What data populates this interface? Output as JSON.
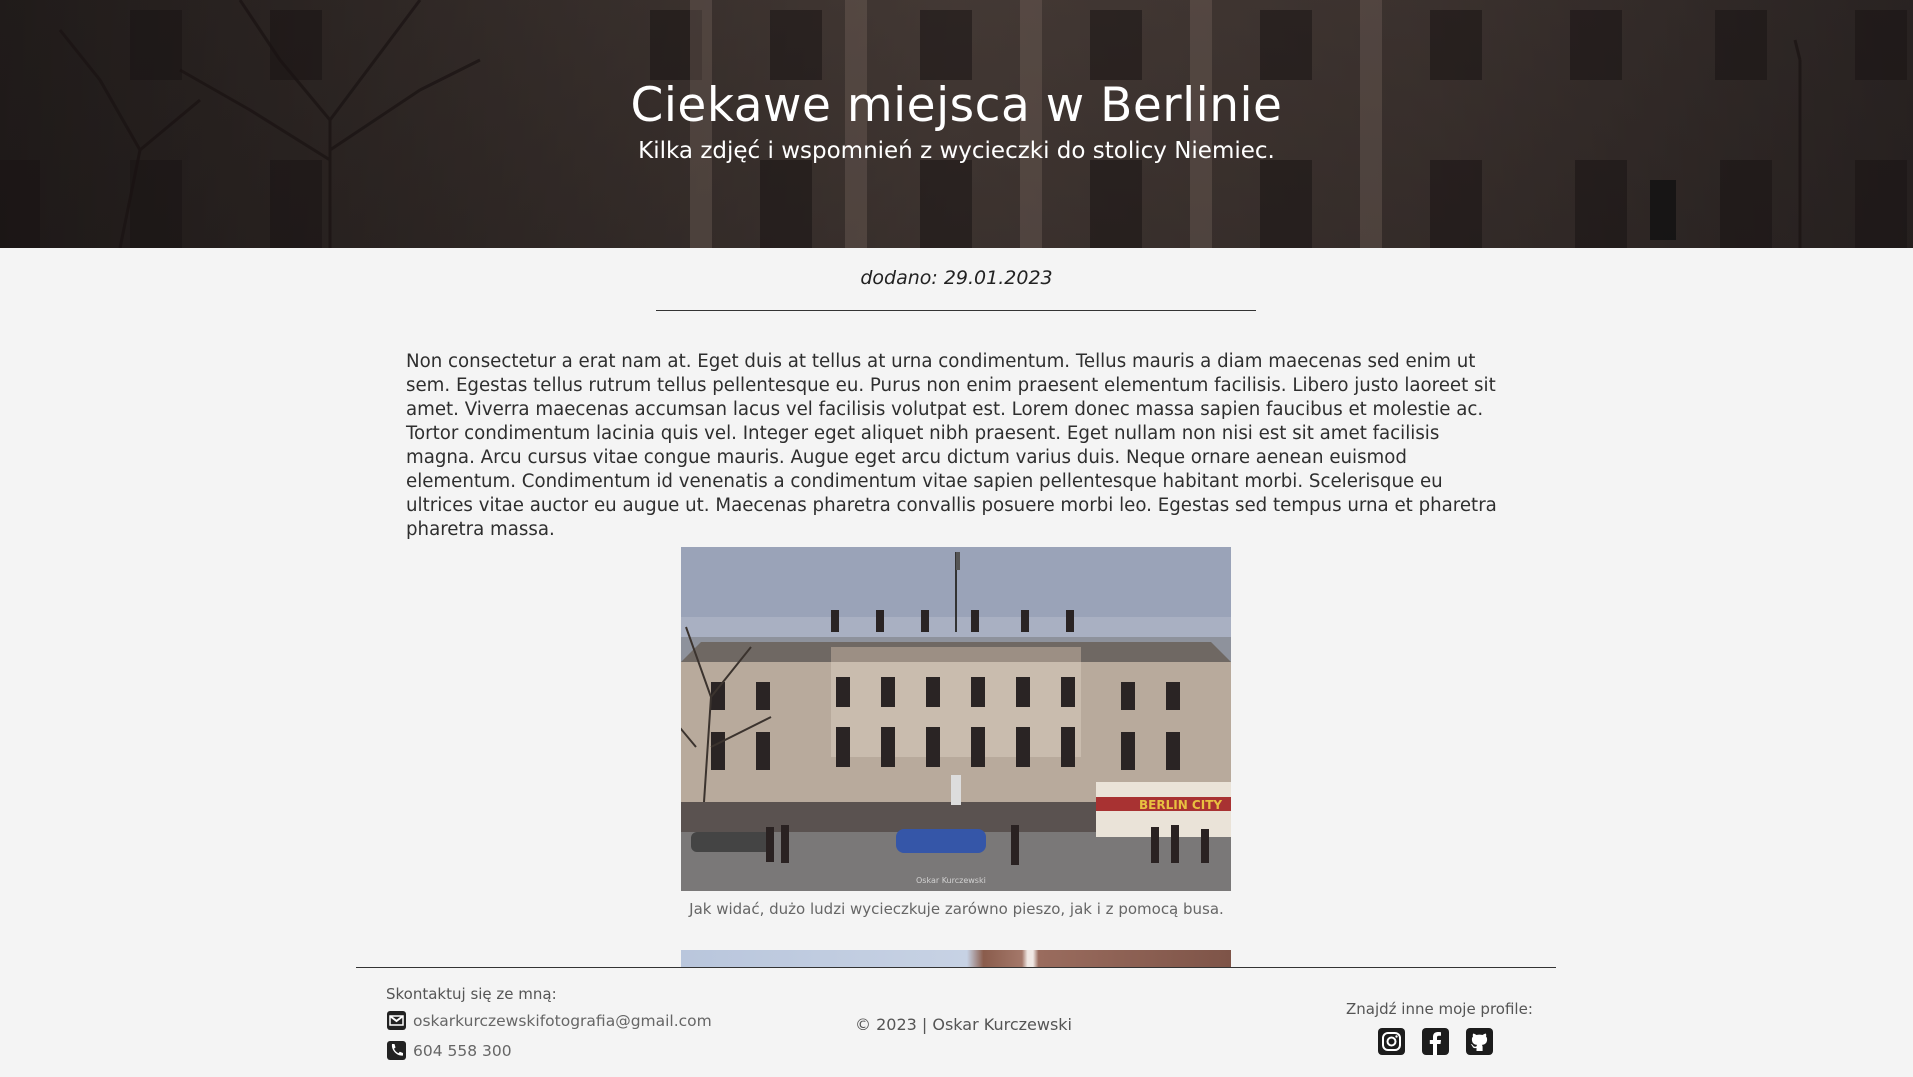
{
  "hero": {
    "title": "Ciekawe miejsca w Berlinie",
    "subtitle": "Kilka zdjęć i wspomnień z wycieczki do stolicy Niemiec."
  },
  "post": {
    "date": "dodano: 29.01.2023",
    "body": "Non consectetur a erat nam at. Eget duis at tellus at urna condimentum. Tellus mauris a diam maecenas sed enim ut sem. Egestas tellus rutrum tellus pellentesque eu. Purus non enim praesent elementum facilisis. Libero justo laoreet sit amet. Viverra maecenas accumsan lacus vel facilisis volutpat est. Lorem donec massa sapien faucibus et molestie ac. Tortor condimentum lacinia quis vel. Integer eget aliquet nibh praesent. Eget nullam non nisi est sit amet facilisis magna. Arcu cursus vitae congue mauris. Augue eget arcu dictum varius duis. Neque ornare aenean euismod elementum. Condimentum id venenatis a condimentum vitae sapien pellentesque habitant morbi. Scelerisque eu ultrices vitae auctor eu augue ut. Maecenas pharetra convallis posuere morbi leo. Egestas sed tempus urna et pharetra pharetra massa.",
    "photo_caption": "Jak widać, dużo ludzi wycieczkuje zarówno pieszo, jak i z pomocą busa.",
    "photo_bus_sign": "BERLIN CITY",
    "photo_watermark": "Oskar Kurczewski"
  },
  "footer": {
    "contact_title": "Skontaktuj się ze mną:",
    "email": "oskarkurczewskifotografia@gmail.com",
    "phone": "604 558 300",
    "copyright": "© 2023 | Oskar Kurczewski",
    "profiles_title": "Znajdź inne moje profile:",
    "icons": {
      "email": "envelope-icon",
      "phone": "phone-icon",
      "socials": [
        "instagram-icon",
        "facebook-icon",
        "github-icon"
      ]
    }
  },
  "colors": {
    "background": "#f4f4f4",
    "text": "#2e2e2e",
    "hero_text": "#ffffff"
  }
}
